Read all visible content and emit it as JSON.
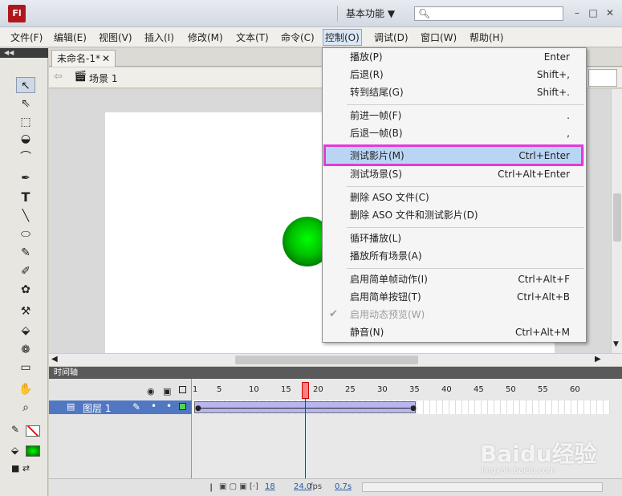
{
  "app": {
    "logo_text": "Fl",
    "workspace": "基本功能 ▼"
  },
  "menubar": [
    {
      "label": "文件(F)"
    },
    {
      "label": "编辑(E)"
    },
    {
      "label": "视图(V)"
    },
    {
      "label": "插入(I)"
    },
    {
      "label": "修改(M)"
    },
    {
      "label": "文本(T)"
    },
    {
      "label": "命令(C)"
    },
    {
      "label": "控制(O)"
    },
    {
      "label": "调试(D)"
    },
    {
      "label": "窗口(W)"
    },
    {
      "label": "帮助(H)"
    }
  ],
  "document": {
    "tab_title": "未命名-1*",
    "scene": "场景 1"
  },
  "control_menu": {
    "items": [
      {
        "label": "播放(P)",
        "shortcut": "Enter"
      },
      {
        "label": "后退(R)",
        "shortcut": "Shift+,"
      },
      {
        "label": "转到结尾(G)",
        "shortcut": "Shift+."
      },
      {
        "label": "前进一帧(F)",
        "shortcut": "."
      },
      {
        "label": "后退一帧(B)",
        "shortcut": ","
      },
      {
        "label": "测试影片(M)",
        "shortcut": "Ctrl+Enter"
      },
      {
        "label": "测试场景(S)",
        "shortcut": "Ctrl+Alt+Enter"
      },
      {
        "label": "删除 ASO 文件(C)",
        "shortcut": ""
      },
      {
        "label": "删除 ASO 文件和测试影片(D)",
        "shortcut": ""
      },
      {
        "label": "循环播放(L)",
        "shortcut": ""
      },
      {
        "label": "播放所有场景(A)",
        "shortcut": ""
      },
      {
        "label": "启用简单帧动作(I)",
        "shortcut": "Ctrl+Alt+F"
      },
      {
        "label": "启用简单按钮(T)",
        "shortcut": "Ctrl+Alt+B"
      },
      {
        "label": "启用动态预览(W)",
        "shortcut": ""
      },
      {
        "label": "静音(N)",
        "shortcut": "Ctrl+Alt+M"
      }
    ],
    "highlighted": "测试影片(M)"
  },
  "timeline": {
    "title": "时间轴",
    "layer_name": "图层 1",
    "frame_numbers": [
      "1",
      "5",
      "10",
      "15",
      "20",
      "25",
      "30",
      "35",
      "40",
      "45",
      "50",
      "55",
      "60"
    ],
    "current_frame": "18",
    "frame_rate": "24.0",
    "fps_unit": "fps",
    "elapsed": "0.7s"
  },
  "watermark": {
    "text": "Baidu经验",
    "sub": "jingyan.baidu.com"
  },
  "colors": {
    "highlight_box": "#e33ad8",
    "menu_hover": "#b9d5f3",
    "layer_selected": "#5177c3",
    "ball": "#00ff00"
  }
}
